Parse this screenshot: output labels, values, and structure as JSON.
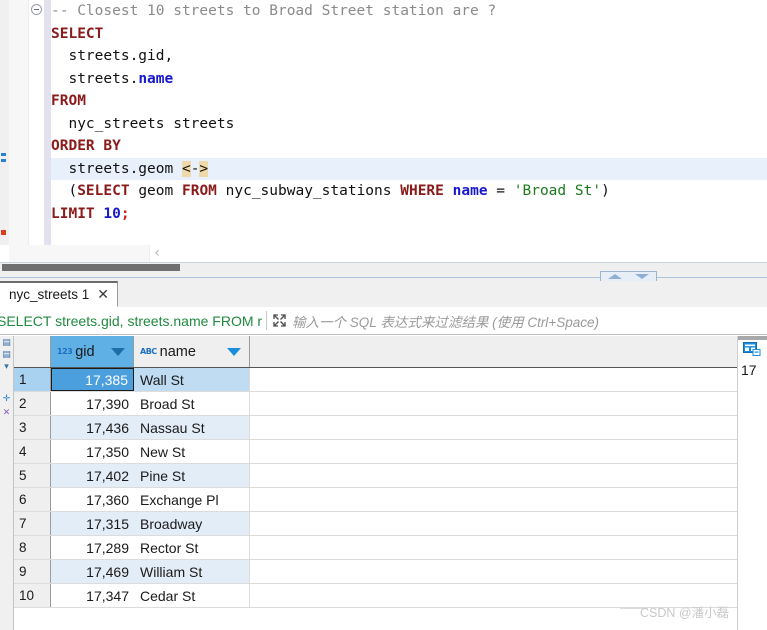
{
  "editor": {
    "fold_marker": "collapse-marker",
    "lines": [
      {
        "id": "l1",
        "highlight": false,
        "tokens": [
          {
            "t": "-- Closest 10 streets to Broad Street station are ?",
            "c": "cm"
          }
        ]
      },
      {
        "id": "l2",
        "highlight": false,
        "tokens": [
          {
            "t": "SELECT",
            "c": "kw"
          }
        ]
      },
      {
        "id": "l3",
        "highlight": false,
        "tokens": [
          {
            "t": "  streets.gid,",
            "c": "punct"
          }
        ]
      },
      {
        "id": "l4",
        "highlight": false,
        "tokens": [
          {
            "t": "  streets.",
            "c": "punct"
          },
          {
            "t": "name",
            "c": "col"
          }
        ]
      },
      {
        "id": "l5",
        "highlight": false,
        "tokens": [
          {
            "t": "FROM",
            "c": "kw"
          }
        ]
      },
      {
        "id": "l6",
        "highlight": false,
        "tokens": [
          {
            "t": "  nyc_streets streets",
            "c": "punct"
          }
        ]
      },
      {
        "id": "l7",
        "highlight": false,
        "tokens": [
          {
            "t": "ORDER BY",
            "c": "kw"
          }
        ]
      },
      {
        "id": "l8",
        "highlight": true,
        "tokens": [
          {
            "t": "  streets.geom ",
            "c": "punct"
          },
          {
            "t": "<",
            "c": "op-hl"
          },
          {
            "t": "-",
            "c": "punct"
          },
          {
            "t": ">",
            "c": "op-hl"
          }
        ]
      },
      {
        "id": "l9",
        "highlight": false,
        "tokens": [
          {
            "t": "  (",
            "c": "punct"
          },
          {
            "t": "SELECT",
            "c": "kw"
          },
          {
            "t": " geom ",
            "c": "punct"
          },
          {
            "t": "FROM",
            "c": "kw"
          },
          {
            "t": " nyc_subway_stations ",
            "c": "punct"
          },
          {
            "t": "WHERE",
            "c": "kw"
          },
          {
            "t": " ",
            "c": "punct"
          },
          {
            "t": "name",
            "c": "col"
          },
          {
            "t": " = ",
            "c": "punct"
          },
          {
            "t": "'Broad St'",
            "c": "str"
          },
          {
            "t": ")",
            "c": "punct"
          }
        ]
      },
      {
        "id": "l10",
        "highlight": false,
        "tokens": [
          {
            "t": "LIMIT",
            "c": "kw"
          },
          {
            "t": " ",
            "c": "punct"
          },
          {
            "t": "10",
            "c": "num"
          },
          {
            "t": ";",
            "c": "semi"
          }
        ]
      }
    ],
    "collapse_chevron": "‹"
  },
  "splitter": {
    "up_arrow": "collapse-up-arrow",
    "down_arrow": "collapse-down-arrow"
  },
  "results_tab": {
    "label": "nyc_streets 1",
    "close": "✕"
  },
  "filter": {
    "sql_text": "SELECT streets.gid, streets.name FROM r",
    "expand_icon": "expand-icon",
    "placeholder": "输入一个 SQL 表达式来过滤结果 (使用 Ctrl+Space)"
  },
  "grid": {
    "columns": [
      {
        "key": "gid",
        "label": "gid",
        "type_icon": "123",
        "selected": true
      },
      {
        "key": "name",
        "label": "name",
        "type_icon": "ABC",
        "selected": false
      }
    ],
    "rows": [
      {
        "idx": "1",
        "gid": "17,385",
        "name": "Wall St"
      },
      {
        "idx": "2",
        "gid": "17,390",
        "name": "Broad St"
      },
      {
        "idx": "3",
        "gid": "17,436",
        "name": "Nassau St"
      },
      {
        "idx": "4",
        "gid": "17,350",
        "name": "New St"
      },
      {
        "idx": "5",
        "gid": "17,402",
        "name": "Pine St"
      },
      {
        "idx": "6",
        "gid": "17,360",
        "name": "Exchange Pl"
      },
      {
        "idx": "7",
        "gid": "17,315",
        "name": "Broadway"
      },
      {
        "idx": "8",
        "gid": "17,289",
        "name": "Rector St"
      },
      {
        "idx": "9",
        "gid": "17,469",
        "name": "William St"
      },
      {
        "idx": "10",
        "gid": "17,347",
        "name": "Cedar St"
      }
    ]
  },
  "right_panel": {
    "icon": "grid-panel-icon",
    "value": "17"
  },
  "watermark": {
    "text": "CSDN @潘小磊"
  },
  "colors": {
    "keyword": "#8b1a1a",
    "column": "#1818cf",
    "string": "#1c7a1c",
    "comment": "#8a8a8a",
    "filter_sql": "#1f8a3f",
    "header_selected": "#5fb0e5",
    "row_selected": "#4a9fdc",
    "alt_row": "#e3edf8",
    "operator_highlight": "#f0d9a8"
  }
}
